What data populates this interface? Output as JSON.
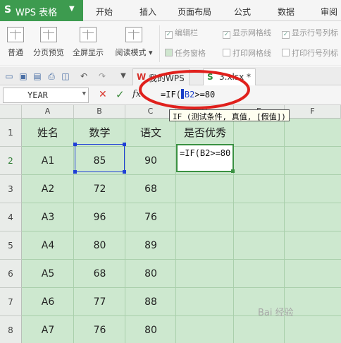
{
  "menu": {
    "app_logo": "S",
    "app_name": "WPS 表格",
    "items": [
      "开始",
      "插入",
      "页面布局",
      "公式",
      "数据",
      "审阅"
    ]
  },
  "ribbon": {
    "buttons": [
      "普通",
      "分页预览",
      "全屏显示",
      "阅读模式"
    ],
    "read_mode_arrow": "▾",
    "checkboxes": [
      {
        "label": "编辑栏",
        "checked": true
      },
      {
        "label": "显示网格线",
        "checked": true
      },
      {
        "label": "显示行号列标",
        "checked": true
      },
      {
        "label": "任务窗格",
        "checked": false
      },
      {
        "label": "打印网格线",
        "checked": false
      },
      {
        "label": "打印行号列标",
        "checked": false
      }
    ]
  },
  "doc_tabs": [
    {
      "label": "我的WPS",
      "icon": "W",
      "active": false
    },
    {
      "label": "3.xlsx *",
      "icon": "S",
      "active": true
    }
  ],
  "formula_bar": {
    "name_box": "YEAR",
    "fx_label": "fx",
    "formula_prefix": "=IF(",
    "formula_ref": "B2",
    "formula_suffix": ">=80"
  },
  "columns": [
    "A",
    "B",
    "C",
    "D",
    "E",
    "F"
  ],
  "rows": [
    {
      "num": "1",
      "a": "姓名",
      "b": "数学",
      "c": "语文",
      "d": "是否优秀"
    },
    {
      "num": "2",
      "a": "A1",
      "b": "85",
      "c": "90",
      "d": ""
    },
    {
      "num": "3",
      "a": "A2",
      "b": "72",
      "c": "68",
      "d": ""
    },
    {
      "num": "4",
      "a": "A3",
      "b": "96",
      "c": "76",
      "d": ""
    },
    {
      "num": "5",
      "a": "A4",
      "b": "80",
      "c": "89",
      "d": ""
    },
    {
      "num": "6",
      "a": "A5",
      "b": "68",
      "c": "80",
      "d": ""
    },
    {
      "num": "7",
      "a": "A6",
      "b": "77",
      "c": "88",
      "d": ""
    },
    {
      "num": "8",
      "a": "A7",
      "b": "76",
      "c": "80",
      "d": ""
    }
  ],
  "editing_cell": {
    "content": "=IF(B2>=80"
  },
  "tooltip": "IF (测试条件, 真值, [假值])",
  "watermark": "Bai 经验",
  "colors": {
    "app_green": "#3d9b4f",
    "grid_bg": "#cde8cf",
    "selection_blue": "#1f3fd6",
    "annotation_red": "#e0201c"
  }
}
